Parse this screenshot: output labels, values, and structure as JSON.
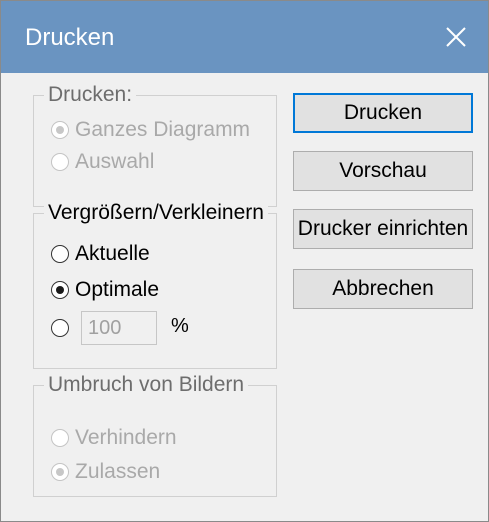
{
  "window": {
    "title": "Drucken"
  },
  "groups": {
    "drucken": {
      "legend": "Drucken:",
      "options": [
        {
          "label": "Ganzes Diagramm",
          "selected": true,
          "enabled": false
        },
        {
          "label": "Auswahl",
          "selected": false,
          "enabled": false
        }
      ]
    },
    "scale": {
      "legend": "Vergrößern/Verkleinern",
      "options": [
        {
          "label": "Aktuelle",
          "selected": false,
          "enabled": true
        },
        {
          "label": "Optimale",
          "selected": true,
          "enabled": true
        },
        {
          "label": "",
          "selected": false,
          "enabled": true
        }
      ],
      "percent_value": "100",
      "percent_unit": "%"
    },
    "umbruch": {
      "legend": "Umbruch von Bildern",
      "options": [
        {
          "label": "Verhindern",
          "selected": false,
          "enabled": false
        },
        {
          "label": "Zulassen",
          "selected": true,
          "enabled": false
        }
      ]
    }
  },
  "buttons": {
    "print": "Drucken",
    "preview": "Vorschau",
    "printer_setup": "Drucker einrichten",
    "cancel": "Abbrechen"
  },
  "icons": {
    "close": "close-icon"
  }
}
